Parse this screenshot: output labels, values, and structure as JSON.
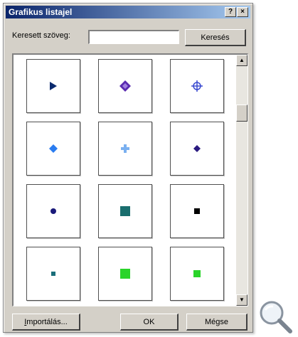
{
  "dialog": {
    "title": "Grafikus listajel",
    "help_label": "?",
    "close_label": "×"
  },
  "search": {
    "label": "Keresett szöveg:",
    "value": "",
    "button_label": "Keresés"
  },
  "gallery": {
    "scroll_up": "▲",
    "scroll_down": "▼",
    "items": [
      {
        "name": "bullet-triangle",
        "shape": "triangle",
        "color": "#0a2a6e"
      },
      {
        "name": "bullet-diamond-star",
        "shape": "diamond-star",
        "color": "#5a2ab0"
      },
      {
        "name": "bullet-crosshair",
        "shape": "crosshair",
        "color": "#3a4ad0"
      },
      {
        "name": "bullet-diamond-blue",
        "shape": "diamond",
        "color": "#2a7cf0"
      },
      {
        "name": "bullet-cross-light",
        "shape": "cross",
        "color": "#7ab0f0"
      },
      {
        "name": "bullet-diamond-navy",
        "shape": "diamond-small",
        "color": "#2a1a80"
      },
      {
        "name": "bullet-dot-navy",
        "shape": "dot",
        "color": "#1a1a7a"
      },
      {
        "name": "bullet-square-teal",
        "shape": "square-large",
        "color": "#1a6e6e"
      },
      {
        "name": "bullet-square-black",
        "shape": "square-small",
        "color": "#000000"
      },
      {
        "name": "bullet-square-teal-small",
        "shape": "square-tiny",
        "color": "#1a6e7a"
      },
      {
        "name": "bullet-square-green",
        "shape": "square-large",
        "color": "#2ad42a"
      },
      {
        "name": "bullet-square-green-small",
        "shape": "square-medium",
        "color": "#2ad42a"
      }
    ]
  },
  "buttons": {
    "import_first": "I",
    "import_rest": "mportálás...",
    "ok": "OK",
    "cancel": "Mégse"
  },
  "magnifier_icon": "magnifier-icon"
}
